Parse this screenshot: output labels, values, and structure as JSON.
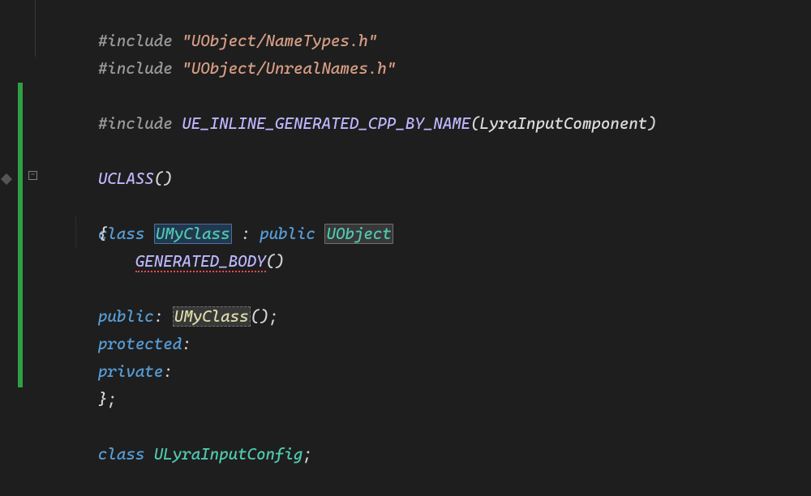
{
  "code": {
    "line1": {
      "include": "#include",
      "str": "\"UObject/NameTypes.h\""
    },
    "line2": {
      "include": "#include",
      "str": "\"UObject/UnrealNames.h\""
    },
    "line4": {
      "include": "#include",
      "macro": "UE_INLINE_GENERATED_CPP_BY_NAME",
      "arg": "LyraInputComponent"
    },
    "line6": {
      "macro": "UCLASS",
      "parens": "()"
    },
    "line7": {
      "kw_class": "class",
      "classname": "UMyClass",
      "colon": " : ",
      "kw_public": "public",
      "base": "UObject"
    },
    "line8_brace": "{",
    "line9": {
      "macro": "GENERATED_BODY",
      "parens": "()"
    },
    "line11": {
      "kw": "public",
      "colon": ": ",
      "ctor": "UMyClass",
      "parens": "();"
    },
    "line12": {
      "kw": "protected",
      "colon": ":"
    },
    "line13": {
      "kw": "private",
      "colon": ":"
    },
    "line14_brace": "};",
    "line16": {
      "kw_class": "class",
      "name": "ULyraInputConfig",
      "semi": ";"
    }
  },
  "fold_symbol": "−"
}
